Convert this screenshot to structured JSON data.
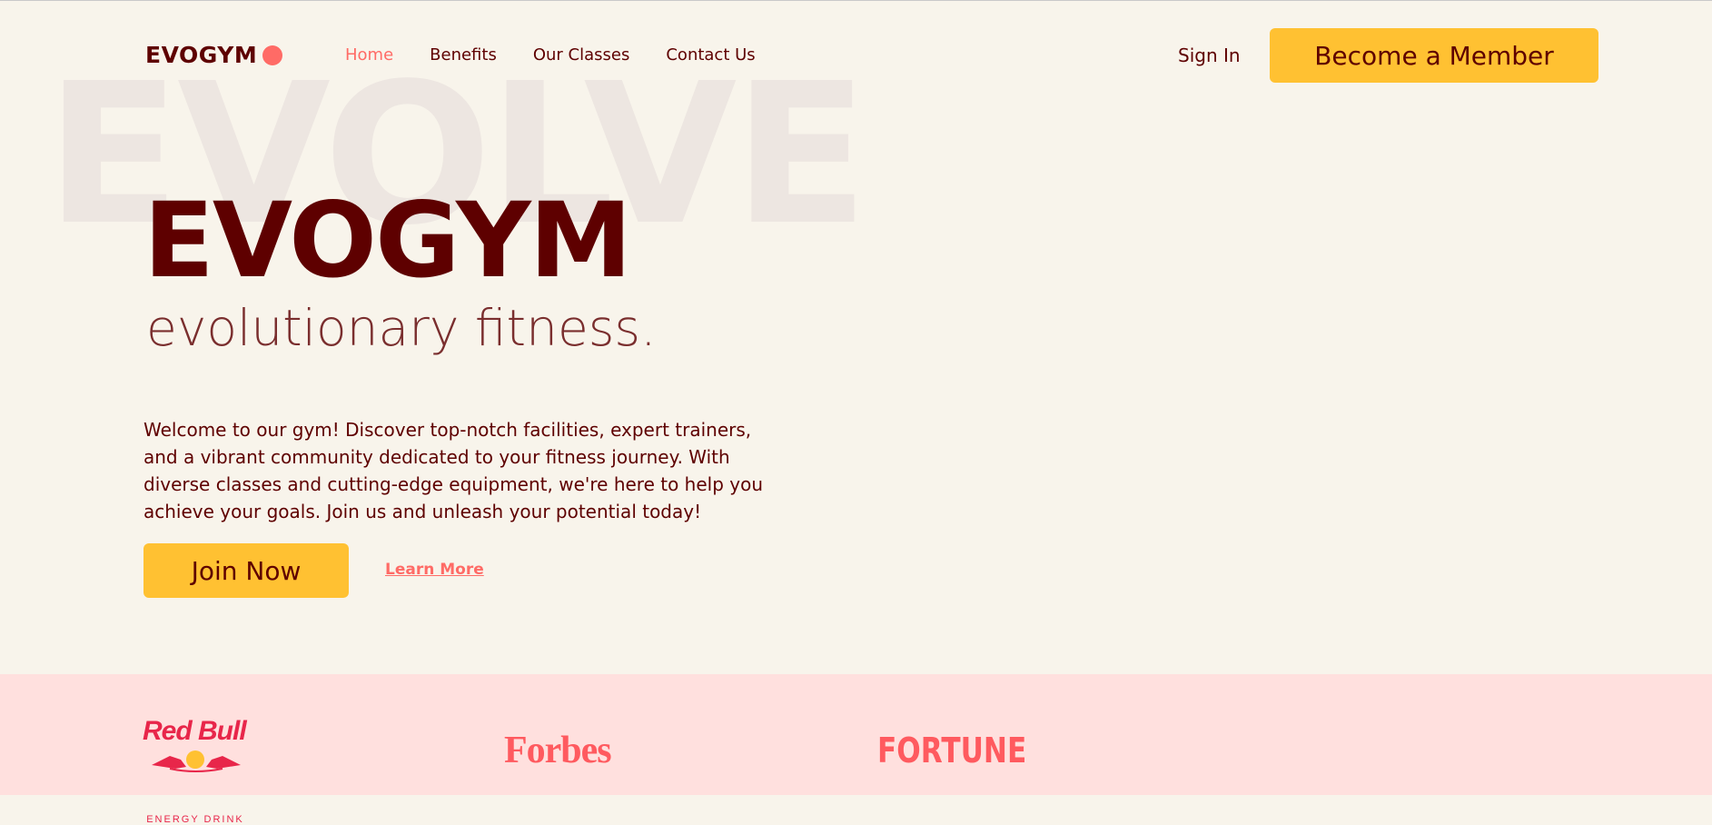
{
  "nav": {
    "logo_text": "EVOGYM",
    "links": [
      {
        "label": "Home",
        "active": true
      },
      {
        "label": "Benefits",
        "active": false
      },
      {
        "label": "Our Classes",
        "active": false
      },
      {
        "label": "Contact Us",
        "active": false
      }
    ],
    "sign_in": "Sign In",
    "become_member": "Become a Member"
  },
  "hero": {
    "bg_word": "EVOLVE",
    "title": "EVOGYM",
    "subtitle": "evolutionary fitness.",
    "description": "Welcome to our gym! Discover top-notch facilities, expert trainers, and a vibrant community dedicated to your fitness journey. With diverse classes and cutting-edge equipment, we're here to help you achieve your goals. Join us and unleash your potential today!",
    "join_button": "Join Now",
    "learn_more": "Learn More"
  },
  "sponsors": {
    "redbull": "Red Bull",
    "redbull_sub": "ENERGY DRINK",
    "forbes": "Forbes",
    "fortune": "FORTUNE"
  },
  "colors": {
    "background": "#f8f4eb",
    "primary_text": "#5e0000",
    "accent": "#ff6b66",
    "button": "#ffc132",
    "sponsor_band": "#ffe0de"
  }
}
